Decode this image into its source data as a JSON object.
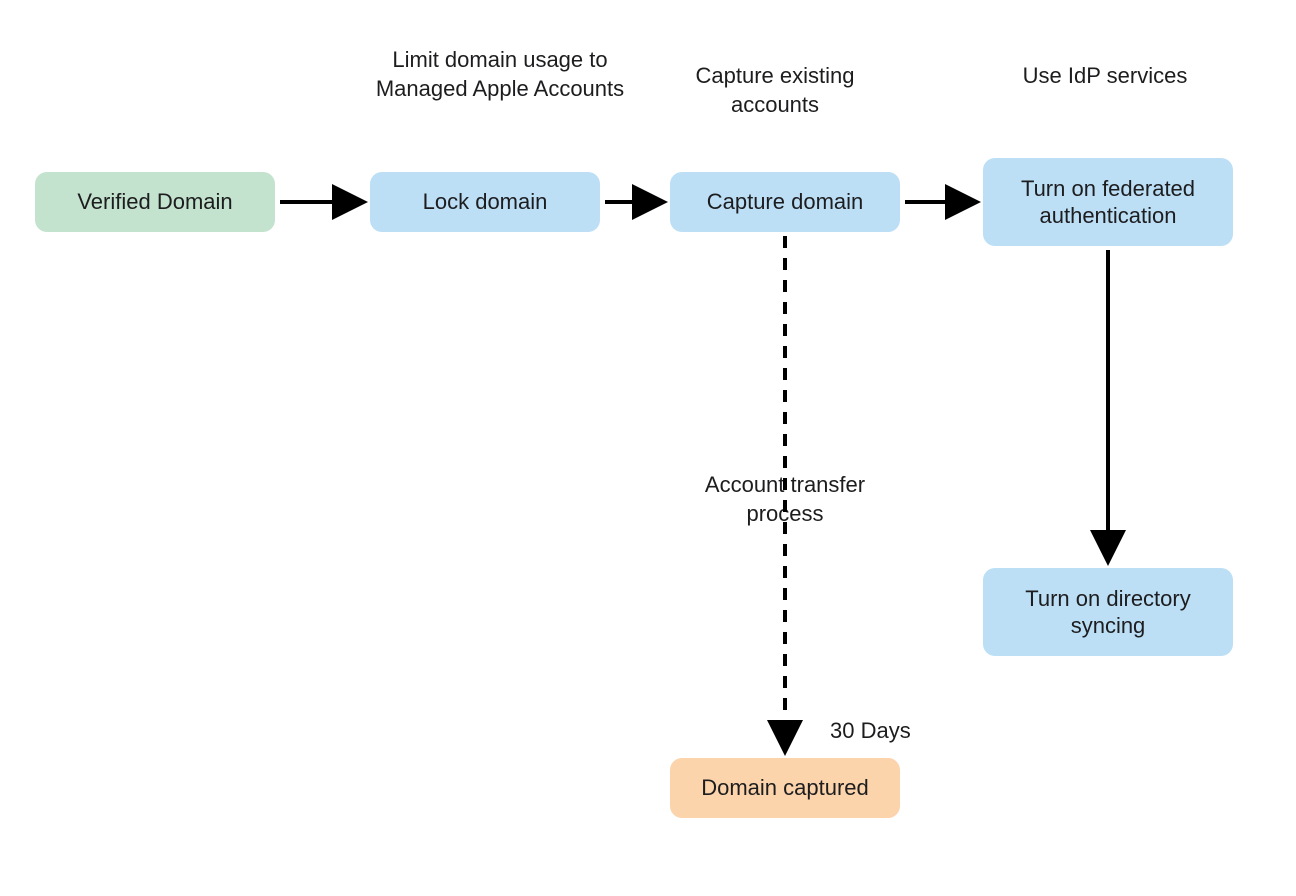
{
  "captions": {
    "lock": "Limit domain usage to Managed Apple Accounts",
    "capture": "Capture existing accounts",
    "federated": "Use IdP services"
  },
  "nodes": {
    "verified": "Verified Domain",
    "lock": "Lock domain",
    "capture": "Capture domain",
    "federated": "Turn on federated authentication",
    "directory": "Turn on directory syncing",
    "captured": "Domain captured"
  },
  "labels": {
    "transfer": "Account transfer process",
    "duration": "30 Days"
  },
  "colors": {
    "green": "#c3e3ce",
    "blue": "#bcdff6",
    "orange": "#fcd4ab",
    "text": "#1d1d1f",
    "arrow": "#000000"
  }
}
